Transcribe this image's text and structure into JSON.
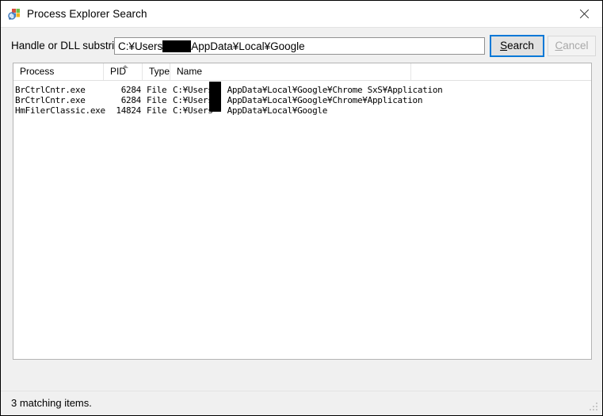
{
  "window": {
    "title": "Process Explorer Search",
    "icon": "process-explorer-icon",
    "close_label": "✕",
    "background_color": "#f0f0f0"
  },
  "search": {
    "label": "Handle or DLL substring:",
    "value_prefix": "C:¥Users",
    "value_suffix": "AppData¥Local¥Google",
    "placeholder": "",
    "redacted": true,
    "buttons": {
      "search": {
        "label": "Search",
        "accelerator": "S",
        "enabled": true,
        "focused": true,
        "focus_color": "#0078d7"
      },
      "cancel": {
        "label": "Cancel",
        "accelerator": "C",
        "enabled": false
      }
    }
  },
  "results": {
    "columns": [
      {
        "key": "process",
        "label": "Process",
        "sorted": false
      },
      {
        "key": "pid",
        "label": "PID",
        "sorted": true,
        "sort_direction": "ascending"
      },
      {
        "key": "type",
        "label": "Type",
        "sorted": false
      },
      {
        "key": "name",
        "label": "Name",
        "sorted": false
      }
    ],
    "rows": [
      {
        "process": "BrCtrlCntr.exe",
        "pid": "6284",
        "type": "File",
        "name_prefix": "C:¥Users",
        "name_suffix": "AppData¥Local¥Google¥Chrome SxS¥Application"
      },
      {
        "process": "BrCtrlCntr.exe",
        "pid": "6284",
        "type": "File",
        "name_prefix": "C:¥Users",
        "name_suffix": "AppData¥Local¥Google¥Chrome¥Application"
      },
      {
        "process": "HmFilerClassic.exe",
        "pid": "14824",
        "type": "File",
        "name_prefix": "C:¥Users",
        "name_suffix": "AppData¥Local¥Google"
      }
    ]
  },
  "statusbar": {
    "text": "3 matching items."
  }
}
